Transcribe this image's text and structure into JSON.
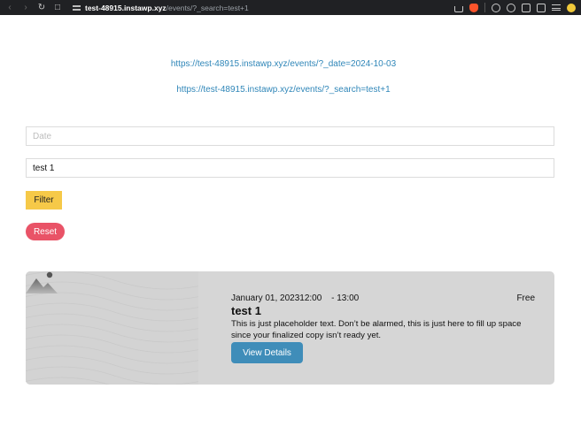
{
  "browser": {
    "url_host": "test-48915.instawp.xyz",
    "url_path": "/events/?_search=test+1"
  },
  "links": [
    {
      "text": "https://test-48915.instawp.xyz/events/?_date=2024-10-03"
    },
    {
      "text": "https://test-48915.instawp.xyz/events/?_search=test+1"
    }
  ],
  "filters": {
    "date_placeholder": "Date",
    "search_value": "test 1",
    "filter_label": "Filter",
    "reset_label": "Reset"
  },
  "event": {
    "date": "January 01, 2023",
    "start_time": "12:00",
    "end_time": "- 13:00",
    "price": "Free",
    "title": "test 1",
    "description": "This is just placeholder text. Don’t be alarmed, this is just here to fill up space since your finalized copy isn’t ready yet.",
    "button_label": "View Details",
    "image_icon": "image-placeholder-icon"
  },
  "colors": {
    "link": "#2f86b8",
    "filter_button": "#f6c948",
    "reset_button": "#e95367",
    "details_button": "#3f8db9",
    "card_background": "#d6d6d6"
  }
}
